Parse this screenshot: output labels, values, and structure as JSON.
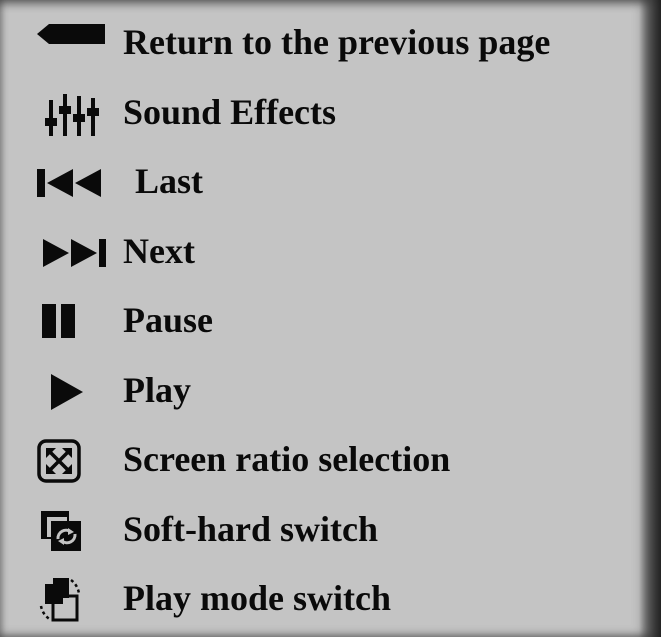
{
  "legend": {
    "items": [
      {
        "icon": "back-arrow-icon",
        "label": "Return to the previous page"
      },
      {
        "icon": "equalizer-icon",
        "label": "Sound Effects"
      },
      {
        "icon": "skip-previous-icon",
        "label": "Last"
      },
      {
        "icon": "skip-next-icon",
        "label": "Next"
      },
      {
        "icon": "pause-icon",
        "label": "Pause"
      },
      {
        "icon": "play-icon",
        "label": "Play"
      },
      {
        "icon": "aspect-ratio-icon",
        "label": "Screen ratio selection"
      },
      {
        "icon": "decoder-switch-icon",
        "label": "Soft-hard switch"
      },
      {
        "icon": "play-mode-icon",
        "label": "Play mode switch"
      }
    ]
  },
  "colors": {
    "panel_background": "#c4c4c4",
    "foreground": "#0a0a0a"
  }
}
